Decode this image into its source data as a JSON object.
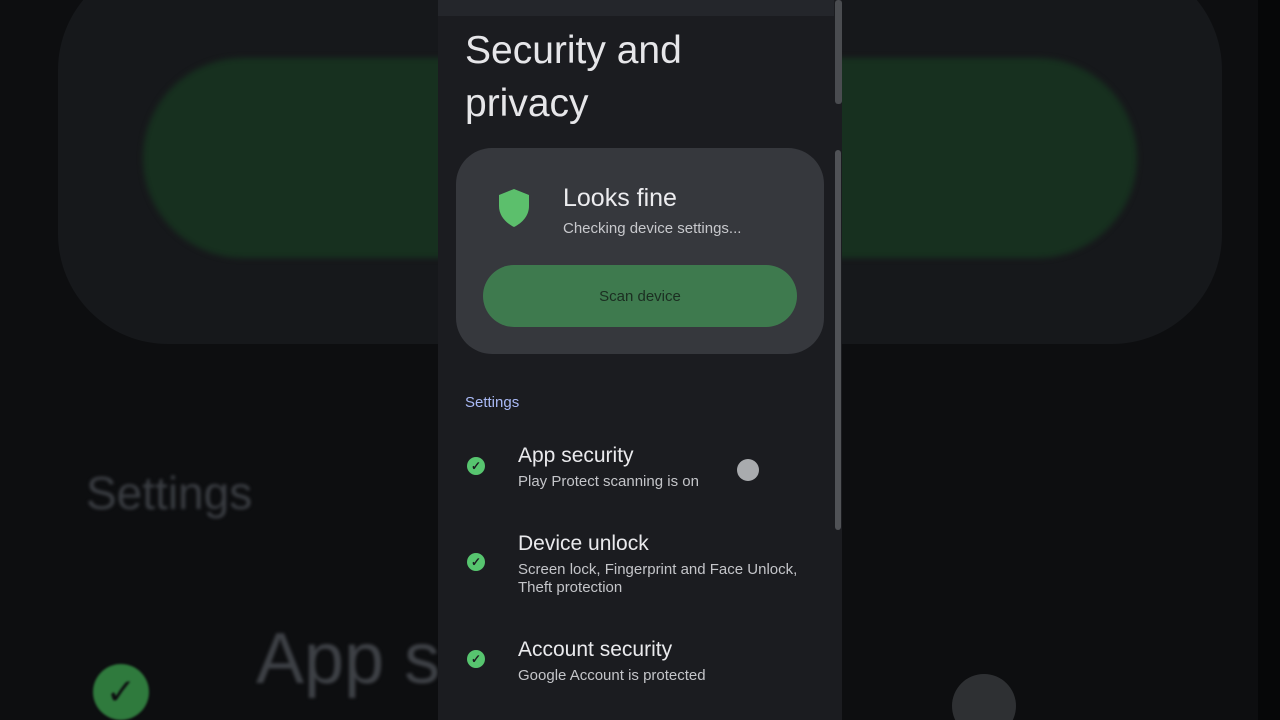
{
  "background": {
    "settings_heading": "Settings",
    "app_text": "App s"
  },
  "page": {
    "title": "Security and privacy"
  },
  "status_card": {
    "icon": "shield-icon",
    "title": "Looks fine",
    "subtitle": "Checking device settings...",
    "scan_button": "Scan device",
    "accent_color": "#5cbf6c"
  },
  "settings": {
    "label": "Settings",
    "items": [
      {
        "title": "App security",
        "subtitle": "Play Protect scanning is on",
        "status": "check"
      },
      {
        "title": "Device unlock",
        "subtitle": "Screen lock, Fingerprint and Face Unlock, Theft protection",
        "status": "check"
      },
      {
        "title": "Account security",
        "subtitle": "Google Account is protected",
        "status": "check"
      }
    ]
  }
}
